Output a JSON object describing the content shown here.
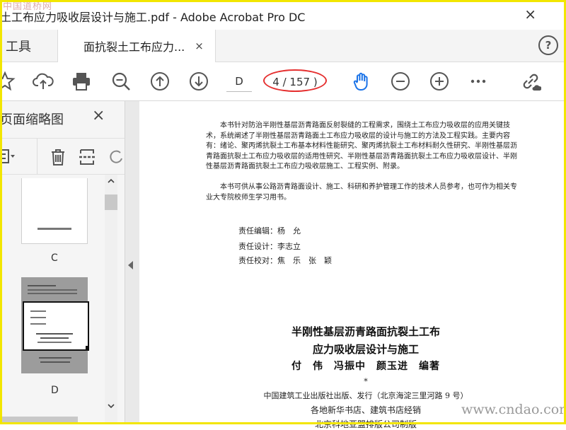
{
  "watermark_top": "中国道桥网",
  "window": {
    "title": "土工布应力吸收层设计与施工.pdf - Adobe Acrobat Pro DC",
    "close": "×"
  },
  "tabs": {
    "tools": "工具",
    "document": "面抗裂土工布应力...",
    "document_close": "×",
    "help": "?"
  },
  "toolbar": {
    "icons": [
      "star-icon",
      "cloud-upload-icon",
      "print-icon",
      "zoom-out-icon",
      "page-up-icon",
      "page-down-icon",
      "hand-icon",
      "minus-icon",
      "plus-icon",
      "more-icon",
      "link-icon"
    ],
    "page_value": "D",
    "page_count": "4 / 157 )"
  },
  "sidebar": {
    "title": "页面缩略图",
    "close": "×",
    "thumbnails": [
      {
        "label": "C"
      },
      {
        "label": "D"
      }
    ]
  },
  "document": {
    "intro": "本书针对防治半刚性基层沥青路面反射裂缝的工程需求，围绕土工布应力吸收层的应用关键技术，系统阐述了半刚性基层沥青路面土工布应力吸收层的设计与施工的方法及工程实践。主要内容有：绪论、聚丙烯抗裂土工布基本材料性能研究、聚丙烯抗裂土工布材料耐久性研究、半刚性基层沥青路面抗裂土工布应力吸收层的适用性研究、半刚性基层沥青路面抗裂土工布应力吸收层设计、半刚性基层沥青路面抗裂土工布应力吸收层施工、工程实例、附录。",
    "audience": "本书可供从事公路沥青路面设计、施工、科研和养护管理工作的技术人员参考，也可作为相关专业大专院校师生学习用书。",
    "credits": [
      "责任编辑：杨　允",
      "责任设计：李志立",
      "责任校对：焦　乐　张　颖"
    ],
    "book_title_1": "半刚性基层沥青路面抗裂土工布",
    "book_title_2": "应力吸收层设计与施工",
    "authors": "付　伟　冯振中　颜玉进　编著",
    "asterisk": "*",
    "publisher": "中国建筑工业出版社出版、发行（北京海淀三里河路 9 号）",
    "distribution": "各地新华书店、建筑书店经销",
    "printer_cut": "北京科地亚盟排版公司制版"
  },
  "watermark_br": "www.cndao.com"
}
